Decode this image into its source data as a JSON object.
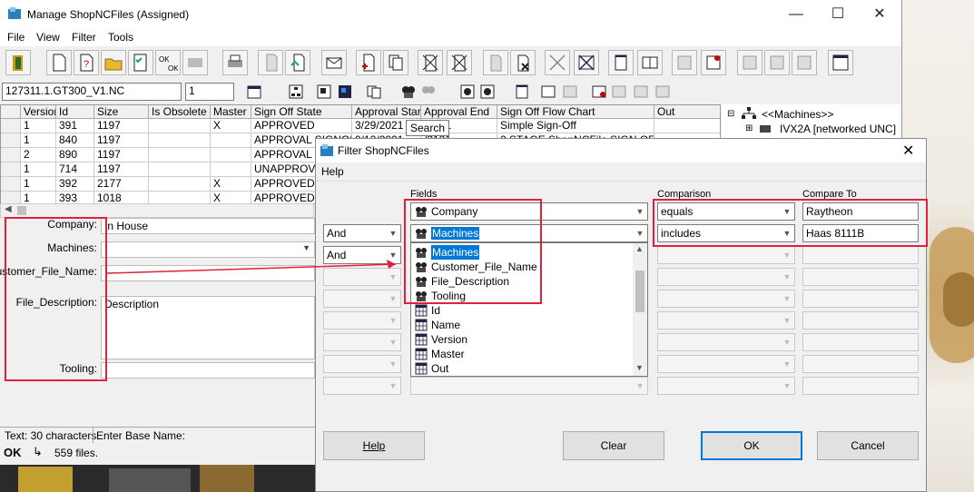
{
  "main": {
    "title": "Manage ShopNCFiles (Assigned)",
    "menu": [
      "File",
      "View",
      "Filter",
      "Tools"
    ],
    "filename_field": "127311.1.GT300_V1.NC",
    "version_field": "1",
    "tooltip": "Search",
    "grid": {
      "headers": [
        "Version",
        "Id",
        "Size",
        "Is Obsolete",
        "Master",
        "Sign Off State",
        "Approval Start",
        "Approval End",
        "Sign Off Flow Chart",
        "Out"
      ],
      "rows": [
        [
          "1",
          "391",
          "1197",
          "",
          "X",
          "APPROVED",
          "3/29/2021",
          "/2121",
          "Simple Sign-Off",
          ""
        ],
        [
          "1",
          "840",
          "1197",
          "",
          "",
          "APPROVAL SIGNOFF",
          "9/13/2021",
          "/2121",
          "2 STAGE ShopNCFile SIGN OFF",
          ""
        ],
        [
          "2",
          "890",
          "1197",
          "",
          "",
          "APPROVAL S",
          "",
          "",
          "",
          ""
        ],
        [
          "1",
          "714",
          "1197",
          "",
          "",
          "UNAPPROVE",
          "",
          "",
          "",
          ""
        ],
        [
          "1",
          "392",
          "2177",
          "",
          "X",
          "APPROVED",
          "",
          "",
          "",
          ""
        ],
        [
          "1",
          "393",
          "1018",
          "",
          "X",
          "APPROVED",
          "",
          "",
          "",
          ""
        ]
      ]
    },
    "tree": {
      "root": "<<Machines>>",
      "child": "IVX2A [networked UNC]"
    },
    "form": {
      "company_label": "Company:",
      "company_value": "In House",
      "machines_label": "Machines:",
      "customer_label": "Customer_File_Name:",
      "description_label": "File_Description:",
      "description_value": "Description",
      "tooling_label": "Tooling:"
    },
    "status": {
      "text_info": "Text: 30 characters",
      "base_name": "Enter Base Name:",
      "ok": "OK",
      "files": "559 files."
    }
  },
  "dialog": {
    "title": "Filter ShopNCFiles",
    "menu": "Help",
    "fields_header": "Fields",
    "comparison_header": "Comparison",
    "compare_to_header": "Compare To",
    "row1": {
      "field": "Company",
      "comparison": "equals",
      "value": "Raytheon"
    },
    "row2": {
      "logic": "And",
      "field": "Machines",
      "comparison": "includes",
      "value": "Haas 8111B"
    },
    "row3": {
      "logic": "And"
    },
    "dropdown_items": [
      {
        "label": "Machines",
        "icon": "machine-icon",
        "selected": true
      },
      {
        "label": "Customer_File_Name",
        "icon": "machine-icon"
      },
      {
        "label": "File_Description",
        "icon": "machine-icon"
      },
      {
        "label": "Tooling",
        "icon": "machine-icon"
      },
      {
        "label": "Id",
        "icon": "table-icon"
      },
      {
        "label": "Name",
        "icon": "table-icon"
      },
      {
        "label": "Version",
        "icon": "table-icon"
      },
      {
        "label": "Master",
        "icon": "table-icon"
      },
      {
        "label": "Out",
        "icon": "table-icon"
      }
    ],
    "buttons": {
      "help": "Help",
      "clear": "Clear",
      "ok": "OK",
      "cancel": "Cancel"
    }
  },
  "colors": {
    "highlight": "#e0203c",
    "selection": "#0078d7"
  }
}
